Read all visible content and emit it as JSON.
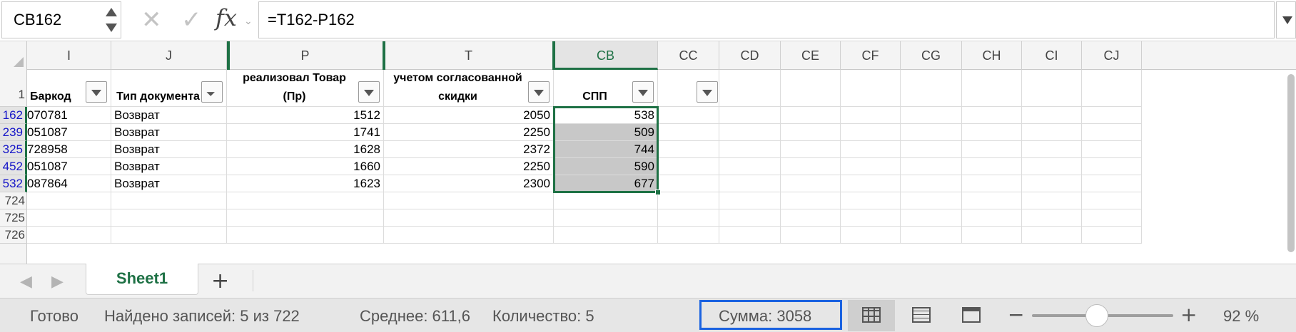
{
  "formula_bar": {
    "name_box": "CB162",
    "formula": "=T162-P162",
    "fx_label": "fx"
  },
  "columns": [
    "I",
    "J",
    "P",
    "T",
    "CB",
    "CC",
    "CD",
    "CE",
    "CF",
    "CG",
    "CH",
    "CI",
    "CJ"
  ],
  "selected_column": "CB",
  "header_row": {
    "row_number": "1",
    "barcode": "Баркод",
    "doc_type": "Тип документа",
    "wb_sold": "Вайлдберриз реализовал Товар (Пр)",
    "retail_price": "Цена розничная с учетом согласованной скидки",
    "spp": "СПП"
  },
  "rows": [
    {
      "row": "162",
      "barcode": "070781",
      "doc_type": "Возврат",
      "wb_sold": "1512",
      "retail_price": "2050",
      "spp": "538"
    },
    {
      "row": "239",
      "barcode": "051087",
      "doc_type": "Возврат",
      "wb_sold": "1741",
      "retail_price": "2250",
      "spp": "509"
    },
    {
      "row": "325",
      "barcode": "728958",
      "doc_type": "Возврат",
      "wb_sold": "1628",
      "retail_price": "2372",
      "spp": "744"
    },
    {
      "row": "452",
      "barcode": "051087",
      "doc_type": "Возврат",
      "wb_sold": "1660",
      "retail_price": "2250",
      "spp": "590"
    },
    {
      "row": "532",
      "barcode": "087864",
      "doc_type": "Возврат",
      "wb_sold": "1623",
      "retail_price": "2300",
      "spp": "677"
    }
  ],
  "empty_rows": [
    "724",
    "725",
    "726"
  ],
  "sheet_tabs": {
    "active": "Sheet1",
    "add_label": "+"
  },
  "status_bar": {
    "ready": "Готово",
    "records_found": "Найдено записей: 5 из 722",
    "average": "Среднее: 611,6",
    "count": "Количество: 5",
    "sum": "Сумма: 3058",
    "zoom": "92 %",
    "zoom_fraction": 0.46
  },
  "colors": {
    "excel_green": "#1e7145",
    "filtered_row_blue": "#1515c8",
    "sum_highlight": "#1a62e0"
  },
  "icons": {
    "cancel": "close-icon",
    "enter": "check-icon",
    "prev": "chevron-left-icon",
    "next": "chevron-right-icon"
  }
}
